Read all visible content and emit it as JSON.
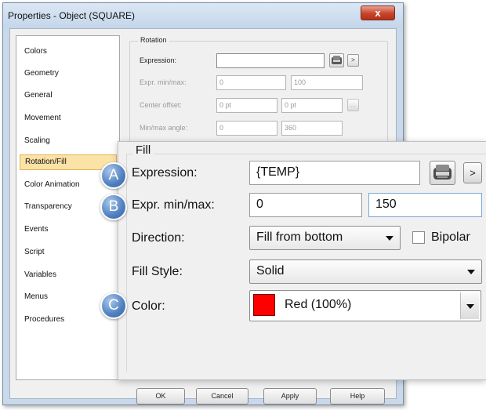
{
  "window": {
    "title": "Properties - Object (SQUARE)",
    "close_label": "x"
  },
  "nav": {
    "items": [
      {
        "label": "Colors"
      },
      {
        "label": "Geometry"
      },
      {
        "label": "General"
      },
      {
        "label": "Movement"
      },
      {
        "label": "Scaling"
      },
      {
        "label": "Rotation/Fill"
      },
      {
        "label": "Color Animation"
      },
      {
        "label": "Transparency"
      },
      {
        "label": "Events"
      },
      {
        "label": "Script"
      },
      {
        "label": "Variables"
      },
      {
        "label": "Menus"
      },
      {
        "label": "Procedures"
      }
    ],
    "selected": "Rotation/Fill"
  },
  "rotation": {
    "legend": "Rotation",
    "expression_label": "Expression:",
    "expression_value": "",
    "expr_minmax_label": "Expr. min/max:",
    "min_value": "0",
    "max_value": "100",
    "center_offset_label": "Center offset:",
    "offset_x": "0 pt",
    "offset_y": "0 pt",
    "offset_button": "...",
    "minmax_angle_label": "Min/max angle:",
    "angle_min": "0",
    "angle_max": "360",
    "arrow_label": ">"
  },
  "fill": {
    "legend": "Fill",
    "expression_label": "Expression:",
    "expression_value": "{TEMP}",
    "arrow_label": ">",
    "expr_minmax_label": "Expr. min/max:",
    "min_value": "0",
    "max_value": "150",
    "direction_label": "Direction:",
    "direction_value": "Fill from bottom",
    "bipolar_label": "Bipolar",
    "bipolar_checked": false,
    "fill_style_label": "Fill Style:",
    "fill_style_value": "Solid",
    "color_label": "Color:",
    "color_value": "Red (100%)",
    "color_hex": "#ff0000"
  },
  "callouts": {
    "a": "A",
    "b": "B",
    "c": "C"
  },
  "footer": {
    "ok": "OK",
    "cancel": "Cancel",
    "apply": "Apply",
    "help": "Help"
  }
}
